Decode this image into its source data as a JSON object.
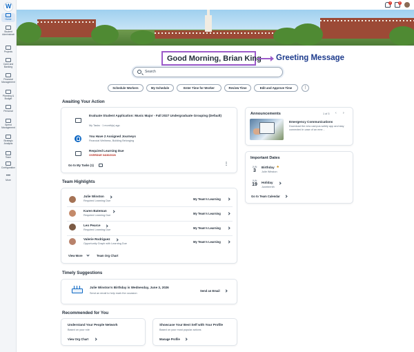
{
  "sidebar": {
    "items": [
      {
        "label": "Home"
      },
      {
        "label": "Student Administrati"
      },
      {
        "label": "Projects"
      },
      {
        "label": "Cash and Banking"
      },
      {
        "label": "Financial Management"
      },
      {
        "label": "Planning & Budget"
      },
      {
        "label": "Personal"
      },
      {
        "label": "Spend Management"
      },
      {
        "label": "Strategic Analysis"
      },
      {
        "label": "Team"
      },
      {
        "label": "Configuration"
      },
      {
        "label": "More"
      }
    ]
  },
  "topbar": {
    "notifications_count": "4",
    "inbox_count": "8"
  },
  "greeting": {
    "text": "Good Morning, Brian King",
    "annotation": "Greeting Message"
  },
  "search": {
    "placeholder": "Search"
  },
  "quick_actions": [
    "Schedule Workers",
    "My Schedule",
    "Enter Time for Worker",
    "Review Time",
    "Edit and Approve Time"
  ],
  "awaiting": {
    "title": "Awaiting Your Action",
    "items": [
      {
        "title": "Evaluate Student Application: Music Major - Fall 2027 Undergraduate Grouping (Default)",
        "sub": "My Tasks · 1 month(s) ago"
      },
      {
        "title": "You Have 2 Assigned Journeys",
        "sub": "Financial Wellness, Building Belonging"
      },
      {
        "title": "Required Learning Due",
        "sub": "OVERDUE 04/30/2026"
      }
    ],
    "footer": "Go to My Tasks (1)"
  },
  "team": {
    "title": "Team Highlights",
    "members": [
      {
        "name": "Julie Winston",
        "sub": "Required Learning Due",
        "link": "My Team's Learning"
      },
      {
        "name": "Karen Bateman",
        "sub": "Required Learning Due",
        "link": "My Team's Learning"
      },
      {
        "name": "Leo Pearce",
        "sub": "Required Learning Due",
        "link": "My Team's Learning"
      },
      {
        "name": "Valerie Rodriguez",
        "sub": "Opportunity Graph with Learning Due",
        "link": "My Team's Learning"
      }
    ],
    "view_more": "View More",
    "org_chart": "Team Org Chart"
  },
  "suggestions": {
    "title": "Timely Suggestions",
    "headline": "Julie Winston's Birthday is Wednesday, June 3, 2026",
    "sub": "Send an email to help mark the occasion",
    "action": "Send an Email"
  },
  "recommended": {
    "title": "Recommended for You",
    "cards": [
      {
        "title": "Understand Your People Network",
        "sub": "Based on your role",
        "link": "View Org Chart"
      },
      {
        "title": "Showcase Your Best Self with Your Profile",
        "sub": "Based on your most popular actions",
        "link": "Manage Profile"
      }
    ]
  },
  "announcements": {
    "title": "Announcements",
    "pager": "1 of 3",
    "item_title": "Emergency Communications",
    "item_body": "Download the new campus safety app and stay connected in case of an eme..."
  },
  "important_dates": {
    "title": "Important Dates",
    "dates": [
      {
        "month": "JUN",
        "day": "3",
        "title": "Birthday",
        "sub": "Julie Winston"
      },
      {
        "month": "JUN",
        "day": "19",
        "title": "Holiday",
        "sub": "Juneteenth"
      }
    ],
    "footer": "Go to Team Calendar"
  },
  "colors": {
    "accent": "#0b66c3",
    "annotation": "#9b59c9",
    "annotation_text": "#1c3a8c",
    "overdue": "#b42318"
  }
}
